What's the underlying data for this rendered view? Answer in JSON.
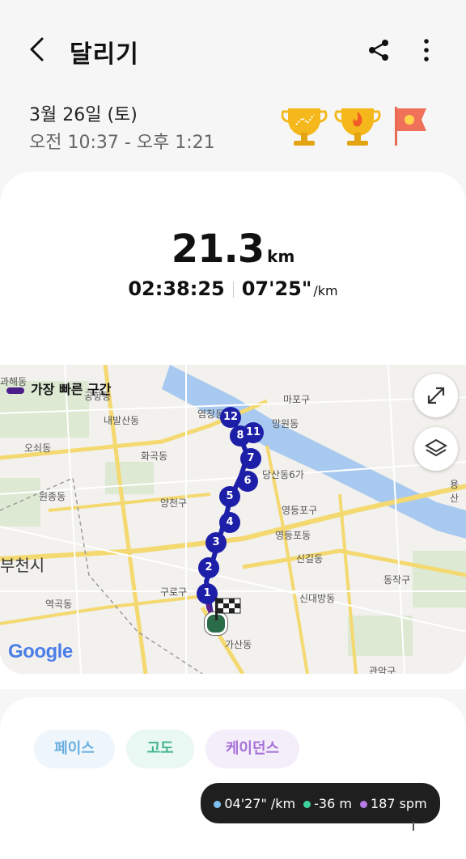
{
  "header": {
    "title": "달리기",
    "back_icon": "chevron-left-icon",
    "share_icon": "share-icon",
    "more_icon": "more-vertical-icon"
  },
  "session": {
    "date": "3월 26일 (토)",
    "time_range": "오전 10:37 - 오후 1:21",
    "badges": [
      "trophy-route-icon",
      "trophy-fire-icon",
      "flag-badge-icon"
    ]
  },
  "summary": {
    "distance": "21.3",
    "distance_unit": "km",
    "duration": "02:38:25",
    "pace": "07'25\"",
    "pace_unit": "/km"
  },
  "map": {
    "legend_label": "가장 빠른 구간",
    "expand_icon": "expand-icon",
    "layers_icon": "layers-icon",
    "attribution": "Google",
    "place_labels": [
      "과해동",
      "공항동",
      "내발산동",
      "오쇠동",
      "화곡동",
      "원종동",
      "양천구",
      "부천시",
      "역곡동",
      "구로구",
      "가산동",
      "마포구",
      "망원동",
      "염창동",
      "당산동6가",
      "영등포구",
      "영등포동",
      "신길동",
      "신대방동",
      "동작구",
      "관악구",
      "용산"
    ],
    "markers": [
      "1",
      "2",
      "3",
      "4",
      "5",
      "6",
      "7",
      "8",
      "11",
      "12"
    ],
    "colors": {
      "river": "#a8c9f0",
      "route": "#1d1fa8",
      "fastest": "#5a1f8e"
    }
  },
  "tabs": [
    {
      "label": "페이스",
      "color": "#6aaee0"
    },
    {
      "label": "고도",
      "color": "#43b58d"
    },
    {
      "label": "케이던스",
      "color": "#a670d6"
    }
  ],
  "tooltip": {
    "pace": "04'27\" /km",
    "altitude": "-36 m",
    "cadence": "187 spm"
  }
}
